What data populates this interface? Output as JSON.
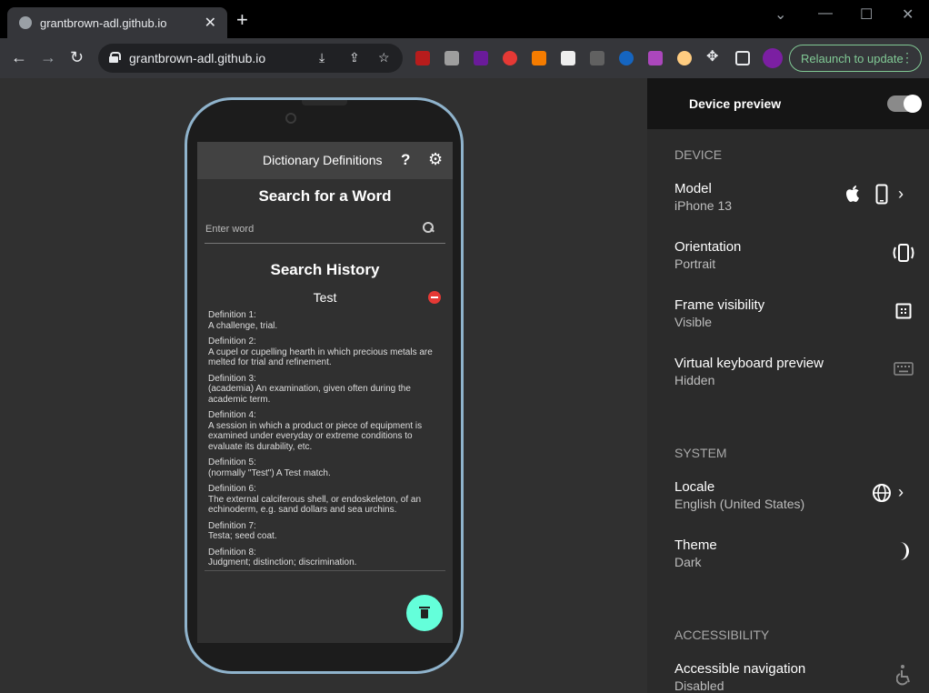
{
  "browser": {
    "tab_title": "grantbrown-adl.github.io",
    "url": "grantbrown-adl.github.io",
    "relaunch_label": "Relaunch to update",
    "icons": [
      "back-icon",
      "forward-icon",
      "reload-icon",
      "lock-icon",
      "install-icon",
      "share-icon",
      "star-icon",
      "extensions-icon",
      "side-panel-icon",
      "menu-icon"
    ]
  },
  "app": {
    "title": "Dictionary Definitions",
    "help_label": "?",
    "search_heading": "Search for a Word",
    "search_placeholder": "Enter word",
    "history_heading": "Search History",
    "entry_word": "Test",
    "definitions": [
      {
        "label": "Definition 1:",
        "text": "A challenge, trial."
      },
      {
        "label": "Definition 2:",
        "text": "A cupel or cupelling hearth in which precious metals are melted for trial and refinement."
      },
      {
        "label": "Definition 3:",
        "text": "(academia) An examination, given often during the academic term."
      },
      {
        "label": "Definition 4:",
        "text": "A session in which a product or piece of equipment is examined under everyday or extreme conditions to evaluate its durability, etc."
      },
      {
        "label": "Definition 5:",
        "text": "(normally \"Test\") A Test match."
      },
      {
        "label": "Definition 6:",
        "text": "The external calciferous shell, or endoskeleton, of an echinoderm, e.g. sand dollars and sea urchins."
      },
      {
        "label": "Definition 7:",
        "text": "Testa; seed coat."
      },
      {
        "label": "Definition 8:",
        "text": "Judgment; distinction; discrimination."
      }
    ],
    "accent_color": "#64ffda",
    "remove_color": "#e53935"
  },
  "panel": {
    "title": "Device preview",
    "toggle_on": true,
    "sections": {
      "device": "DEVICE",
      "system": "SYSTEM",
      "accessibility": "ACCESSIBILITY"
    },
    "model": {
      "title": "Model",
      "value": "iPhone 13"
    },
    "orientation": {
      "title": "Orientation",
      "value": "Portrait"
    },
    "frame": {
      "title": "Frame visibility",
      "value": "Visible"
    },
    "keyboard": {
      "title": "Virtual keyboard preview",
      "value": "Hidden"
    },
    "locale": {
      "title": "Locale",
      "value": "English (United States)"
    },
    "theme": {
      "title": "Theme",
      "value": "Dark"
    },
    "navigation": {
      "title": "Accessible navigation",
      "value": "Disabled"
    }
  }
}
